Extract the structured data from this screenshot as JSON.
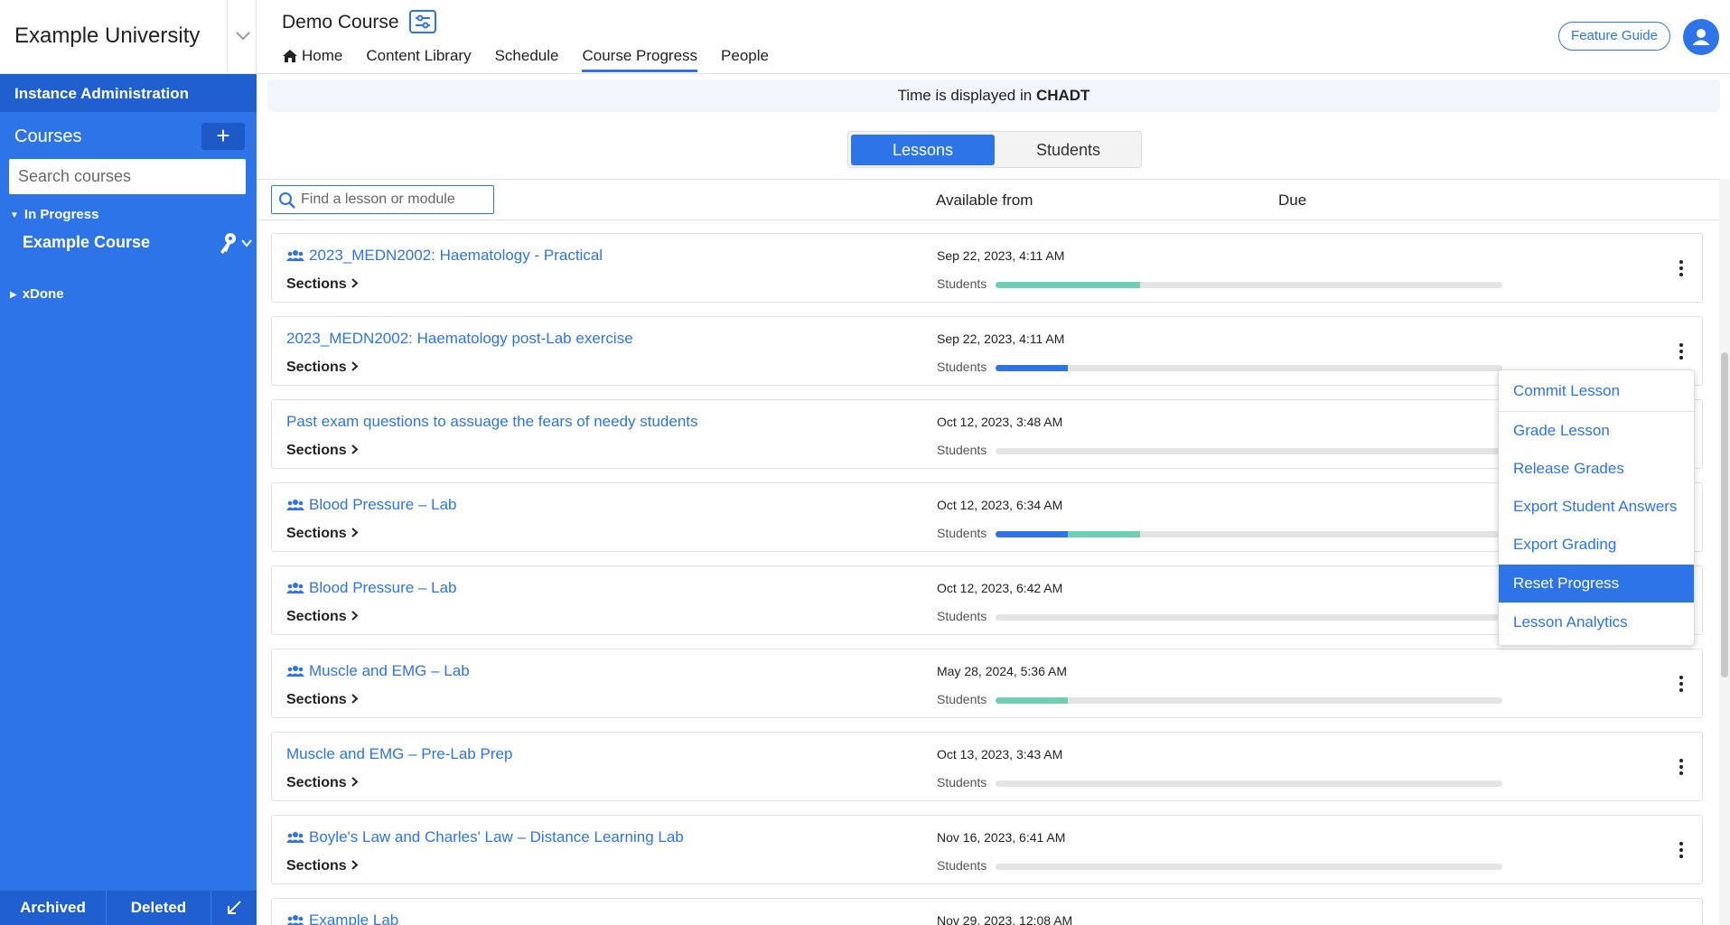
{
  "sidebar": {
    "university": "Example University",
    "admin": "Instance Administration",
    "courses_label": "Courses",
    "add_label": "+",
    "search_placeholder": "Search courses",
    "in_progress": "In Progress",
    "course_item": "Example Course",
    "xdone": "xDone",
    "archived": "Archived",
    "deleted": "Deleted"
  },
  "header": {
    "course_title": "Demo Course",
    "nav": [
      "Home",
      "Content Library",
      "Schedule",
      "Course Progress",
      "People"
    ],
    "active_nav": "Course Progress",
    "feature_guide": "Feature Guide"
  },
  "main": {
    "tz_prefix": "Time is displayed in",
    "tz_zone": "CHADT",
    "toggle": {
      "lessons": "Lessons",
      "students": "Students",
      "selected": "Lessons"
    },
    "find_placeholder": "Find a lesson or module",
    "col_available": "Available from",
    "col_due": "Due",
    "sections_label": "Sections",
    "students_label": "Students"
  },
  "colors": {
    "accent": "#2c74e8",
    "progress_blue": "#2c74e8",
    "progress_teal": "#6fcfb4"
  },
  "lessons": [
    {
      "title": "2023_MEDN2002: Haematology - Practical",
      "group": true,
      "available": "Sep 22, 2023, 4:11 AM",
      "progress_blue": 0,
      "progress_teal": 0.285
    },
    {
      "title": "2023_MEDN2002: Haematology post-Lab exercise",
      "group": false,
      "available": "Sep 22, 2023, 4:11 AM",
      "progress_blue": 0.143,
      "progress_teal": 0
    },
    {
      "title": "Past exam questions to assuage the fears of needy students",
      "group": false,
      "available": "Oct 12, 2023, 3:48 AM",
      "progress_blue": 0,
      "progress_teal": 0
    },
    {
      "title": "Blood Pressure – Lab",
      "group": true,
      "available": "Oct 12, 2023, 6:34 AM",
      "progress_blue": 0.143,
      "progress_teal": 0.143
    },
    {
      "title": "Blood Pressure – Lab",
      "group": true,
      "available": "Oct 12, 2023, 6:42 AM",
      "progress_blue": 0,
      "progress_teal": 0
    },
    {
      "title": "Muscle and EMG – Lab",
      "group": true,
      "available": "May 28, 2024, 5:36 AM",
      "progress_blue": 0,
      "progress_teal": 0.143
    },
    {
      "title": "Muscle and EMG – Pre-Lab Prep",
      "group": false,
      "available": "Oct 13, 2023, 3:43 AM",
      "progress_blue": 0,
      "progress_teal": 0
    },
    {
      "title": "Boyle's Law and Charles' Law – Distance Learning Lab",
      "group": true,
      "available": "Nov 16, 2023, 6:41 AM",
      "progress_blue": 0,
      "progress_teal": 0
    },
    {
      "title": "Example Lab",
      "group": true,
      "available": "Nov 29, 2023, 12:08 AM",
      "progress_blue": 0,
      "progress_teal": 0
    }
  ],
  "context_menu": {
    "items": [
      "Commit Lesson",
      "Grade Lesson",
      "Release Grades",
      "Export Student Answers",
      "Export Grading",
      "Reset Progress",
      "Lesson Analytics"
    ],
    "highlighted": "Reset Progress"
  }
}
